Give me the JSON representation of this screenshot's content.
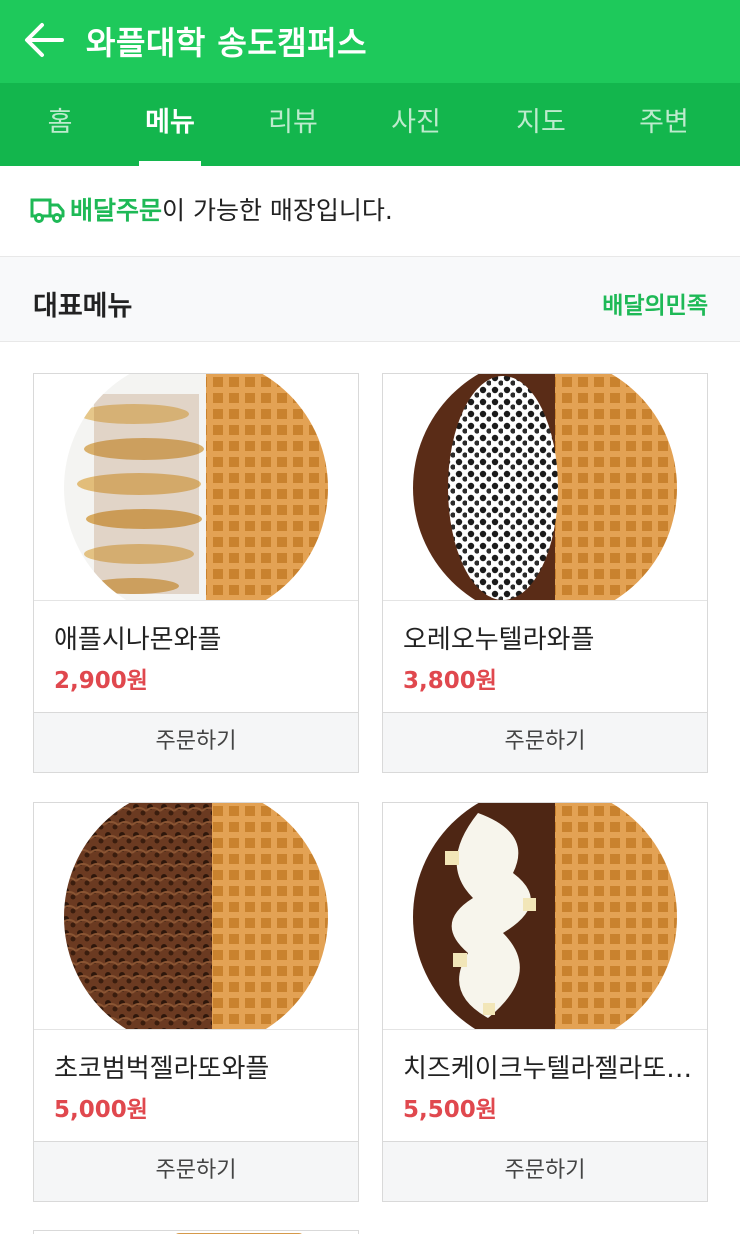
{
  "header": {
    "title": "와플대학 송도캠퍼스",
    "back_icon": "arrow-left-icon"
  },
  "tabs": [
    {
      "label": "홈",
      "active": false
    },
    {
      "label": "메뉴",
      "active": true
    },
    {
      "label": "리뷰",
      "active": false
    },
    {
      "label": "사진",
      "active": false
    },
    {
      "label": "지도",
      "active": false
    },
    {
      "label": "주변",
      "active": false
    }
  ],
  "notice": {
    "highlight": "배달주문",
    "rest": "이 가능한 매장입니다.",
    "icon": "delivery-truck-icon"
  },
  "section": {
    "title": "대표메뉴",
    "link": "배달의민족"
  },
  "menu": [
    {
      "name": "애플시나몬와플",
      "price": "2,900원",
      "order_label": "주문하기"
    },
    {
      "name": "오레오누텔라와플",
      "price": "3,800원",
      "order_label": "주문하기"
    },
    {
      "name": "초코범벅젤라또와플",
      "price": "5,000원",
      "order_label": "주문하기"
    },
    {
      "name": "치즈케이크누텔라젤라또와플",
      "price": "5,500원",
      "order_label": "주문하기"
    }
  ],
  "colors": {
    "brand": "#1ec95b",
    "tab_bar": "#13b64d",
    "accent_text": "#1eb956",
    "price": "#e0484e"
  }
}
